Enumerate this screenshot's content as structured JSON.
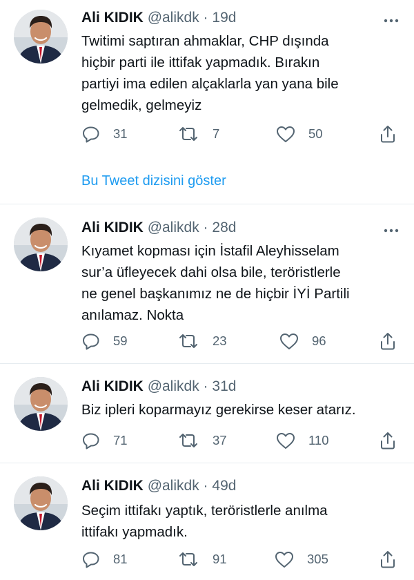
{
  "tweets": [
    {
      "name": "Ali KIDIK",
      "handle": "@alikdk",
      "separator": "·",
      "age": "19d",
      "lines": [
        "Twitimi saptıran ahmaklar, CHP dışında",
        "hiçbir parti ile ittifak yapmadık. Bırakın",
        "partiyi ima edilen alçaklarla yan yana bile",
        "gelmedik, gelmeyiz"
      ],
      "replies": "31",
      "retweets": "7",
      "likes": "50"
    },
    {
      "name": "Ali KIDIK",
      "handle": "@alikdk",
      "separator": "·",
      "age": "28d",
      "lines": [
        "Kıyamet kopması için İstafil Aleyhisselam",
        "sur’a üfleyecek dahi olsa bile, teröristlerle",
        "ne genel başkanımız ne de hiçbir İYİ Partili",
        "anılamaz. Nokta"
      ],
      "replies": "59",
      "retweets": "23",
      "likes": "96"
    },
    {
      "name": "Ali KIDIK",
      "handle": "@alikdk",
      "separator": "·",
      "age": "31d",
      "lines": [
        "Biz ipleri koparmayız gerekirse keser atarız."
      ],
      "replies": "71",
      "retweets": "37",
      "likes": "110"
    },
    {
      "name": "Ali KIDIK",
      "handle": "@alikdk",
      "separator": "·",
      "age": "49d",
      "lines": [
        "Seçim ittifakı yaptık, teröristlerle anılma",
        "ittifakı yapmadık."
      ],
      "replies": "81",
      "retweets": "91",
      "likes": "305"
    }
  ],
  "thread_link": "Bu Tweet dizisini göster",
  "icons": {
    "reply": "reply-icon",
    "retweet": "retweet-icon",
    "like": "heart-icon",
    "share": "share-icon",
    "more": "more-icon"
  },
  "colors": {
    "text": "#0f1419",
    "secondary": "#536471",
    "link": "#1d9bf0",
    "divider": "#e6ecf0"
  }
}
